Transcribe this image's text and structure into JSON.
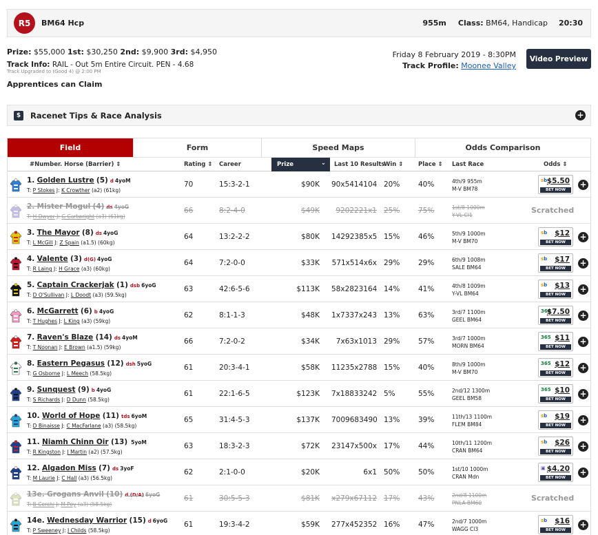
{
  "race": {
    "badge": "R5",
    "name": "BM64 Hcp",
    "distance": "955m",
    "class_label": "Class:",
    "class_value": "BM64, Handicap",
    "time": "20:30"
  },
  "prizes": {
    "prize_label": "Prize:",
    "prize": "$55,000",
    "first_label": "1st:",
    "first": "$30,250",
    "second_label": "2nd:",
    "second": "$9,900",
    "third_label": "3rd:",
    "third": "$4,950"
  },
  "track": {
    "info_label": "Track Info:",
    "info": "RAIL - Out 5m Entire Circuit. PEN - 4.68",
    "upgrade": "Track Upgraded to (Good 4) @ 2:00 PM",
    "apprentices": "Apprentices can Claim",
    "date": "Friday 8 February 2019 - 8:30PM",
    "profile_label": "Track Profile:",
    "profile_link": "Moonee Valley"
  },
  "video_button": "Video Preview",
  "tips_title": "Racenet Tips & Race Analysis",
  "tabs": [
    "Field",
    "Form",
    "Speed Maps",
    "Odds Comparison"
  ],
  "columns": {
    "horse": "#Number. Horse (Barrier) ⇕",
    "rating": "Rating ⇕",
    "career": "Career",
    "prize": "Prize",
    "last10": "Last 10 Results",
    "win": "Win ⇕",
    "place": "Place ⇕",
    "lastrace": "Last Race",
    "odds": "Odds ⇕"
  },
  "scratched_label": "Scratched",
  "runners": [
    {
      "num": "1.",
      "name": "Golden Lustre",
      "barrier": "(5)",
      "tag": "d",
      "age": "4yoM",
      "trainer": "P Stokes",
      "jockey": "K Crowther",
      "extra": "(a2) (61kg)",
      "rating": "70",
      "career": "15:3-2-1",
      "prize": "$90K",
      "last10": "90x5414104",
      "win": "20%",
      "place": "40%",
      "lr1": "4th/9 955m",
      "lr2": "M-V BM78",
      "odds": "$5.50",
      "book": "sb",
      "silk": [
        "#2c7fd4",
        "#ffffff"
      ]
    },
    {
      "num": "2.",
      "name": "Mister Mogul",
      "barrier": "(4)",
      "tag": "ds",
      "age": "4yoG",
      "trainer": "H Dwyer",
      "jockey": "G Cartwright",
      "extra": "(a3) (61kg)",
      "rating": "66",
      "career": "8:2-4-0",
      "prize": "$49K",
      "last10": "9202221x1",
      "win": "25%",
      "place": "75%",
      "lr1": "1st/8 1000m",
      "lr2": "Y-VL Cl1",
      "scratched": true,
      "silk": [
        "#7d6ec9",
        "#dddddd"
      ]
    },
    {
      "num": "3.",
      "name": "The Mayor",
      "barrier": "(8)",
      "tag": "ds",
      "age": "4yoG",
      "trainer": "L McGill",
      "jockey": "Z Spain",
      "extra": "(a1.5) (60kg)",
      "rating": "64",
      "career": "13:2-2-2",
      "prize": "$80K",
      "last10": "14292385x5",
      "win": "15%",
      "place": "46%",
      "lr1": "5th/9 1000m",
      "lr2": "M-V BM70",
      "odds": "$12",
      "book": "sb",
      "silk": [
        "#e8c400",
        "#d41c1c"
      ]
    },
    {
      "num": "4.",
      "name": "Valente",
      "barrier": "(3)",
      "tag": "d(G)",
      "age": "4yoG",
      "trainer": "R Laing",
      "jockey": "H Grace",
      "extra": "(a3) (60kg)",
      "rating": "64",
      "career": "7:2-0-0",
      "prize": "$33K",
      "last10": "571x514x6x",
      "win": "29%",
      "place": "29%",
      "lr1": "6th/9 1008m",
      "lr2": "SALE BM64",
      "odds": "$17",
      "book": "sb",
      "silk": [
        "#c0142c",
        "#111111"
      ]
    },
    {
      "num": "5.",
      "name": "Captain Crackerjak",
      "barrier": "(1)",
      "tag": "dsb",
      "age": "6yoG",
      "trainer": "D O'Sullivan",
      "jockey": "L Doodt",
      "extra": "(a3) (59.5kg)",
      "rating": "63",
      "career": "42:6-5-6",
      "prize": "$113K",
      "last10": "58x2823164",
      "win": "14%",
      "place": "41%",
      "lr1": "4th/8 1009m",
      "lr2": "Y-VL BM64",
      "odds": "$13",
      "book": "sb",
      "silk": [
        "#111111",
        "#e8d400"
      ]
    },
    {
      "num": "6.",
      "name": "McGarrett",
      "barrier": "(6)",
      "tag": "b",
      "age": "4yoG",
      "trainer": "T Hughes",
      "jockey": "L King",
      "extra": "(a3) (59kg)",
      "rating": "62",
      "career": "8:1-1-3",
      "prize": "$48K",
      "last10": "1x7337x243",
      "win": "13%",
      "place": "63%",
      "lr1": "3rd/7 1100m",
      "lr2": "GEEL BM64",
      "odds": "$7.50",
      "book": "365",
      "silk": [
        "#f29bc5",
        "#ffffff"
      ]
    },
    {
      "num": "7.",
      "name": "Raven's Blaze",
      "barrier": "(14)",
      "tag": "ds",
      "age": "4yoM",
      "trainer": "T Noonan",
      "jockey": "E Brown",
      "extra": "(a1.5) (59kg)",
      "rating": "66",
      "career": "7:2-0-2",
      "prize": "$34K",
      "last10": "7x63x1013",
      "win": "29%",
      "place": "57%",
      "lr1": "3rd/7 1000m",
      "lr2": "MORN BM64",
      "odds": "$11",
      "book": "365",
      "silk": [
        "#d41c1c",
        "#ffffff"
      ]
    },
    {
      "num": "8.",
      "name": "Eastern Pegasus",
      "barrier": "(12)",
      "tag": "dsh",
      "age": "5yoG",
      "trainer": "G Osborne",
      "jockey": "L Meech",
      "extra": "(58.5kg)",
      "rating": "61",
      "career": "20:3-4-1",
      "prize": "$58K",
      "last10": "11235x2788",
      "win": "15%",
      "place": "40%",
      "lr1": "8th/9 1000m",
      "lr2": "M-V BM70",
      "odds": "$12",
      "book": "365",
      "silk": [
        "#ffffff",
        "#2a7a4a"
      ]
    },
    {
      "num": "9.",
      "name": "Sunquest",
      "barrier": "(9)",
      "tag": "b",
      "age": "4yoG",
      "trainer": "S Richards",
      "jockey": "D Dunn",
      "extra": "(58.5kg)",
      "rating": "61",
      "career": "22:1-6-5",
      "prize": "$123K",
      "last10": "7x18833242",
      "win": "5%",
      "place": "55%",
      "lr1": "2nd/12 1300m",
      "lr2": "GEEL BM58",
      "odds": "$10",
      "book": "365",
      "silk": [
        "#1d3f8c",
        "#111111"
      ]
    },
    {
      "num": "10.",
      "name": "World of Hope",
      "barrier": "(11)",
      "tag": "tds",
      "age": "6yoM",
      "trainer": "D Binaisse",
      "jockey": "C MacFarlane",
      "extra": "(a3) (58.5kg)",
      "rating": "65",
      "career": "31:4-5-3",
      "prize": "$137K",
      "last10": "7009683490",
      "win": "13%",
      "place": "39%",
      "lr1": "11th/13 1100m",
      "lr2": "FLEM BM84",
      "odds": "$19",
      "book": "sb",
      "silk": [
        "#2aa6d6",
        "#1d3f8c"
      ]
    },
    {
      "num": "11.",
      "name": "Niamh Chinn Oir",
      "barrier": "(13)",
      "tag": "",
      "age": "5yoM",
      "trainer": "R Kingston",
      "jockey": "J Martin",
      "extra": "(a2) (57.5kg)",
      "rating": "63",
      "career": "18:3-2-3",
      "prize": "$72K",
      "last10": "23147x500x",
      "win": "17%",
      "place": "44%",
      "lr1": "10th/11 1200m",
      "lr2": "CRAN BM64",
      "odds": "$26",
      "book": "sb",
      "silk": [
        "#1d3f8c",
        "#d41c1c"
      ]
    },
    {
      "num": "12.",
      "name": "Algadon Miss",
      "barrier": "(7)",
      "tag": "ds",
      "age": "3yoF",
      "trainer": "M Laurie",
      "jockey": "C Hall",
      "extra": "(a3) (56.5kg)",
      "rating": "62",
      "career": "2:1-0-0",
      "prize": "$20K",
      "last10": "6x1",
      "win": "50%",
      "place": "50%",
      "lr1": "1st/10 1000m",
      "lr2": "CRAN Mdn",
      "odds": "$4.20",
      "book": "ub",
      "silk": [
        "#1d3f8c",
        "#ffffff"
      ]
    },
    {
      "num": "13e.",
      "name": "Grogans Anvil",
      "barrier": "(10)",
      "tag": "d (D/A)",
      "age": "6yoG",
      "trainer": "B Cerchi",
      "jockey": "M Poy",
      "extra": "(a3) (58.5kg)",
      "rating": "61",
      "career": "30:5-5-3",
      "prize": "$81K",
      "last10": "x279x67112",
      "win": "17%",
      "place": "43%",
      "lr1": "2nd/8 1100m",
      "lr2": "PNLA BM60",
      "scratched": true,
      "silk": [
        "#b8c27a",
        "#ffffff"
      ]
    },
    {
      "num": "14e.",
      "name": "Wednesday Warrior",
      "barrier": "(15)",
      "tag": "d",
      "age": "6yoG",
      "trainer": "P Sweeney",
      "jockey": "J Childs",
      "extra": "(58.5kg)",
      "rating": "61",
      "career": "19:3-4-2",
      "prize": "$59K",
      "last10": "277x452352",
      "win": "16%",
      "place": "47%",
      "lr1": "2nd/7 1000m",
      "lr2": "WAGG Cl3",
      "odds": "$16",
      "book": "sb",
      "silk": [
        "#2aa6d6",
        "#111111"
      ]
    }
  ]
}
